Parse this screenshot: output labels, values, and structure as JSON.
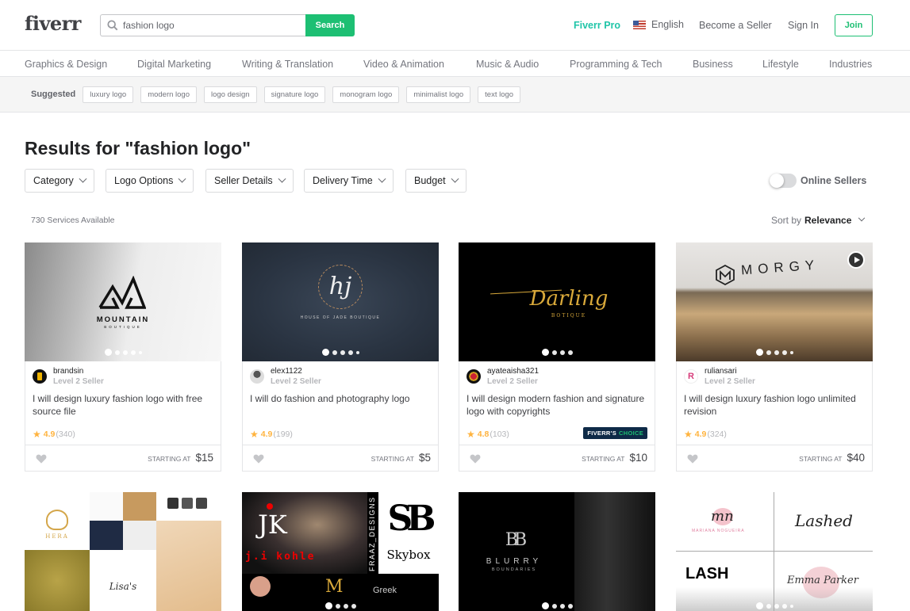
{
  "header": {
    "logo": "fiverr",
    "search": {
      "value": "fashion logo",
      "button": "Search"
    },
    "nav": {
      "pro": "Fiverr Pro",
      "language": "English",
      "become_seller": "Become a Seller",
      "sign_in": "Sign In",
      "join": "Join"
    }
  },
  "categories": [
    "Graphics & Design",
    "Digital Marketing",
    "Writing & Translation",
    "Video & Animation",
    "Music & Audio",
    "Programming & Tech",
    "Business",
    "Lifestyle",
    "Industries"
  ],
  "suggested": {
    "label": "Suggested",
    "chips": [
      "luxury logo",
      "modern logo",
      "logo design",
      "signature logo",
      "monogram logo",
      "minimalist logo",
      "text logo"
    ]
  },
  "results": {
    "title": "Results for \"fashion logo\"",
    "filters": [
      "Category",
      "Logo Options",
      "Seller Details",
      "Delivery Time",
      "Budget"
    ],
    "online_sellers": "Online Sellers",
    "online_sellers_on": false,
    "count": "730 Services Available",
    "sort_label": "Sort by",
    "sort_value": "Relevance"
  },
  "gigs": [
    {
      "seller": "brandsin",
      "level": "Level 2 Seller",
      "title": "I will design luxury fashion logo with free source file",
      "score": "4.9",
      "reviews": "(340)",
      "starting_at": "STARTING AT",
      "price": "$15",
      "thumb_text": "MOUNTAIN",
      "thumb_sub": "BOUTIQUE"
    },
    {
      "seller": "elex1122",
      "level": "Level 2 Seller",
      "title": "I will do fashion and photography logo",
      "score": "4.9",
      "reviews": "(199)",
      "starting_at": "STARTING AT",
      "price": "$5",
      "thumb_text": "hj",
      "thumb_sub": "HOUSE OF JADE BOUTIQUE"
    },
    {
      "seller": "ayateaisha321",
      "level": "Level 2 Seller",
      "title": "I will design modern fashion and signature logo with copyrights",
      "score": "4.8",
      "reviews": "(103)",
      "starting_at": "STARTING AT",
      "price": "$10",
      "badge": "FIVERR'S",
      "badge_accent": "CHOICE",
      "thumb_text": "Darling",
      "thumb_sub": "BOTIQUE"
    },
    {
      "seller": "ruliansari",
      "level": "Level 2 Seller",
      "title": "I will design luxury fashion logo unlimited revision",
      "score": "4.9",
      "reviews": "(324)",
      "starting_at": "STARTING AT",
      "price": "$40",
      "thumb_text": "MORGY"
    }
  ],
  "row2_thumbs": [
    {
      "text": "HERA",
      "sub": "Lisa's"
    },
    {
      "text": "j.i kohle",
      "sub": "Skybox",
      "side": "FRAAZ_DESIGNS"
    },
    {
      "text": "BLURRY",
      "sub": "BOUNDARIES"
    },
    {
      "text": "LASH",
      "sub": "Lashed"
    }
  ],
  "colors": {
    "brand_green": "#1dbf73",
    "pro_teal": "#20c5a8",
    "star": "#ffb33e",
    "choice_bg": "#0e2a47"
  }
}
